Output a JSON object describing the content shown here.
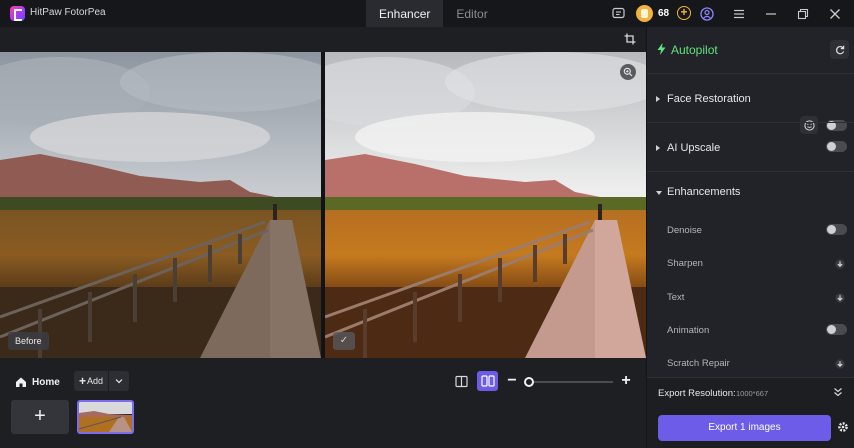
{
  "app": {
    "title": "HitPaw FotorPea"
  },
  "tabs": [
    {
      "label": "Enhancer"
    },
    {
      "label": "Editor"
    }
  ],
  "credits": {
    "count": "68"
  },
  "preview": {
    "before_label": "Before",
    "after_label": "✓"
  },
  "bottom": {
    "home_label": "Home",
    "add_label": "Add",
    "zoom_level": 0.05
  },
  "panel": {
    "autopilot_label": "Autopilot",
    "face_restoration": "Face Restoration",
    "ai_upscale": "AI Upscale",
    "enhancements": "Enhancements",
    "items": [
      {
        "label": "Denoise",
        "control": "toggle"
      },
      {
        "label": "Sharpen",
        "control": "download"
      },
      {
        "label": "Text",
        "control": "download"
      },
      {
        "label": "Animation",
        "control": "toggle"
      },
      {
        "label": "Scratch Repair",
        "control": "download"
      }
    ],
    "export_resolution_label": "Export Resolution:",
    "export_resolution_value": "1000*667",
    "export_button": "Export 1 images"
  },
  "colors": {
    "accent": "#6c5ce7",
    "autopilot": "#5fe37a",
    "credit": "#f2b33d"
  }
}
